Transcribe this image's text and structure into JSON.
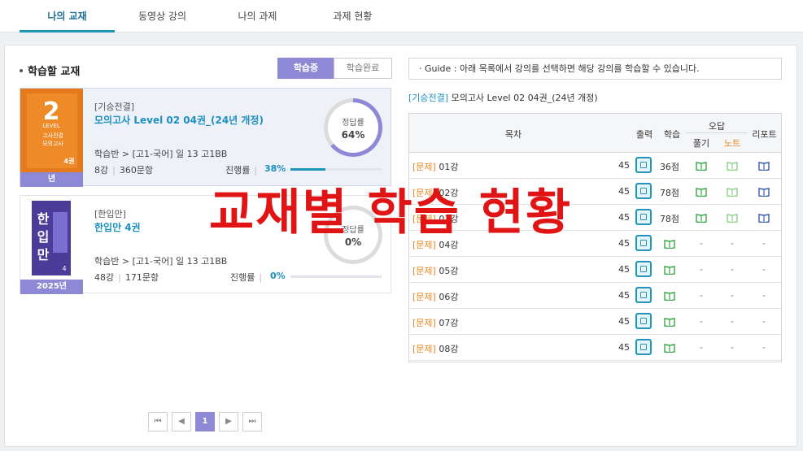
{
  "tabs": [
    {
      "label": "나의 교재",
      "active": true
    },
    {
      "label": "동영상 강의",
      "active": false
    },
    {
      "label": "나의 과제",
      "active": false
    },
    {
      "label": "과제 현황",
      "active": false
    }
  ],
  "left": {
    "section_title": "학습할 교재",
    "toggle_on": "학습중",
    "toggle_off": "학습완료",
    "books": [
      {
        "publisher": "[기승전결]",
        "name": "모의고사 Level 02 04권_(24년 개정)",
        "class": "학습반 > [고1-국어] 일 13 고1BB",
        "lessons": "8강",
        "questions": "360문항",
        "progress_label": "진행률",
        "progress": "38%",
        "progress_value": 38,
        "accuracy_label": "정답률",
        "accuracy": "64%",
        "accuracy_value": 64,
        "year_badge": "년",
        "cover": {
          "color": "#e47a1c",
          "title1": "LEVEL",
          "num": "2",
          "title2": "고사전결",
          "title3": "모의고사",
          "vol": "4권"
        }
      },
      {
        "publisher": "[한입만]",
        "name": "한입만 4권",
        "class": "학습반 > [고1-국어] 일 13 고1BB",
        "lessons": "48강",
        "questions": "171문항",
        "progress_label": "진행률",
        "progress": "0%",
        "progress_value": 0,
        "accuracy_label": "정답률",
        "accuracy": "0%",
        "accuracy_value": 0,
        "year_badge": "2025년",
        "cover": {
          "color": "#4b3c9a",
          "title1": "한",
          "num": "입",
          "title2": "만",
          "title3": "",
          "vol": "4"
        }
      }
    ],
    "pagination": {
      "first": "⏮",
      "prev": "◀",
      "current": "1",
      "next": "▶",
      "last": "⏭"
    }
  },
  "right": {
    "guide": "· Guide : 아래 목록에서 강의를 선택하면 해당 강의를 학습할 수 있습니다.",
    "book_publisher": "[기승전결]",
    "book_name": " 모의고사 Level 02 04권_(24년 개정)",
    "headers": {
      "toc": "목차",
      "print": "출력",
      "study": "학습",
      "wrong": "오답",
      "solve": "풀기",
      "note": "노트",
      "report": "리포트"
    },
    "rows": [
      {
        "tag": "[문제]",
        "title": " 01강",
        "count": "45",
        "score": "36점",
        "solve": "book",
        "note": "book",
        "report": "book"
      },
      {
        "tag": "[문제]",
        "title": " 02강",
        "count": "45",
        "score": "78점",
        "solve": "book",
        "note": "book",
        "report": "book"
      },
      {
        "tag": "[문제]",
        "title": " 03강",
        "count": "45",
        "score": "78점",
        "solve": "book",
        "note": "book",
        "report": "book"
      },
      {
        "tag": "[문제]",
        "title": " 04강",
        "count": "45",
        "score": "",
        "solve": "-",
        "note": "-",
        "report": "-"
      },
      {
        "tag": "[문제]",
        "title": " 05강",
        "count": "45",
        "score": "",
        "solve": "-",
        "note": "-",
        "report": "-"
      },
      {
        "tag": "[문제]",
        "title": " 06강",
        "count": "45",
        "score": "",
        "solve": "-",
        "note": "-",
        "report": "-"
      },
      {
        "tag": "[문제]",
        "title": " 07강",
        "count": "45",
        "score": "",
        "solve": "-",
        "note": "-",
        "report": "-"
      },
      {
        "tag": "[문제]",
        "title": " 08강",
        "count": "45",
        "score": "",
        "solve": "-",
        "note": "-",
        "report": "-"
      }
    ]
  },
  "overlay_text": "교재별 학습 현황",
  "colors": {
    "accent": "#1f95b8",
    "purple": "#8d89d6",
    "tag": "#e8851f",
    "overlay": "#e01414"
  }
}
